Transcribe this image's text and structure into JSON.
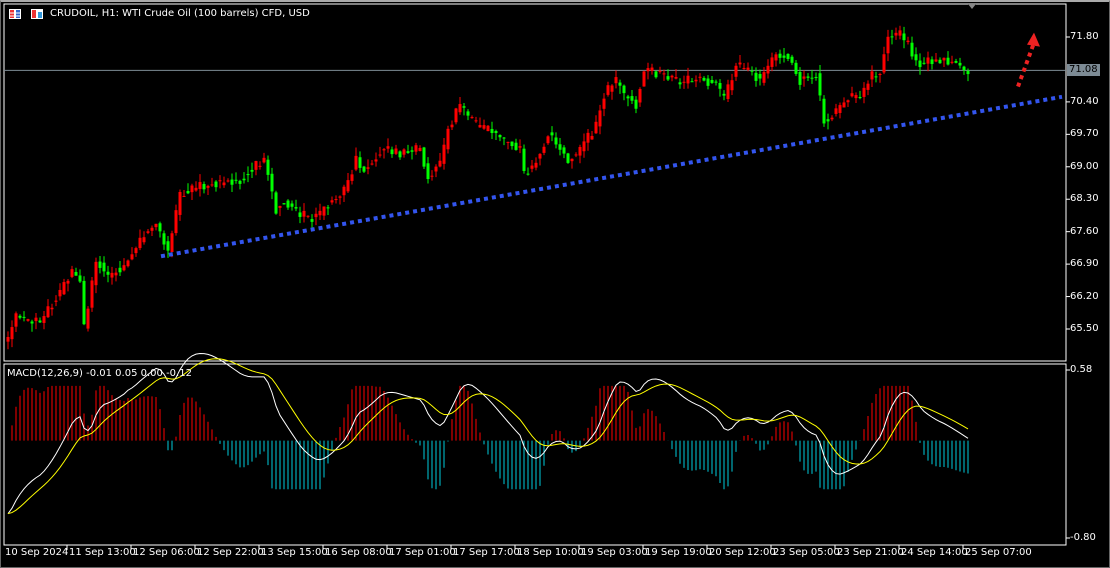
{
  "header": {
    "title": "CRUDOIL, H1:  WTI Crude Oil (100 barrels) CFD, USD",
    "icons": [
      "chart-window-icon",
      "one-click-trading-icon"
    ]
  },
  "macd_panel": {
    "label": "MACD(12,26,9) -0.01 0.05 0.00 -0.12",
    "y_max": "0.58",
    "y_min": "-0.80"
  },
  "colors": {
    "bull": "#ff0000",
    "bear": "#00ff00",
    "trendline": "#3355ee",
    "arrow": "#ee2222",
    "macd_main": "#ffffff",
    "macd_signal": "#ffff00",
    "hist_pos": "#ff0000",
    "hist_neg": "#00ccdd",
    "current_price_line": "#7d8b95"
  },
  "chart_data": {
    "type": "candlestick",
    "symbol": "CRUDOIL",
    "timeframe": "H1",
    "current_price": "71.08",
    "y_ticks": [
      "71.80",
      "70.40",
      "69.70",
      "69.00",
      "68.30",
      "67.60",
      "66.90",
      "66.20",
      "65.50"
    ],
    "ylim": [
      65.2,
      72.5
    ],
    "x_tick_labels": [
      "10 Sep 2024",
      "11 Sep 13:00",
      "12 Sep 06:00",
      "12 Sep 22:00",
      "13 Sep 15:00",
      "16 Sep 08:00",
      "17 Sep 01:00",
      "17 Sep 17:00",
      "18 Sep 10:00",
      "19 Sep 03:00",
      "19 Sep 19:00",
      "20 Sep 12:00",
      "23 Sep 05:00",
      "23 Sep 21:00",
      "24 Sep 14:00",
      "25 Sep 07:00"
    ],
    "bars_per_x_tick": 16,
    "close_path": [
      [
        0,
        65.3
      ],
      [
        2,
        65.74
      ],
      [
        8,
        65.69
      ],
      [
        12,
        66.17
      ],
      [
        16,
        66.71
      ],
      [
        18,
        66.5
      ],
      [
        19,
        65.53
      ],
      [
        22,
        66.99
      ],
      [
        25,
        66.66
      ],
      [
        29,
        66.88
      ],
      [
        33,
        67.42
      ],
      [
        37,
        67.8
      ],
      [
        40,
        67.2
      ],
      [
        43,
        68.4
      ],
      [
        45,
        68.5
      ],
      [
        50,
        68.62
      ],
      [
        58,
        68.73
      ],
      [
        62,
        69.05
      ],
      [
        64,
        69.16
      ],
      [
        67,
        68.07
      ],
      [
        69,
        68.29
      ],
      [
        73,
        67.96
      ],
      [
        77,
        67.9
      ],
      [
        80,
        68.18
      ],
      [
        84,
        68.5
      ],
      [
        87,
        69.16
      ],
      [
        89,
        68.94
      ],
      [
        93,
        69.36
      ],
      [
        98,
        69.31
      ],
      [
        103,
        69.4
      ],
      [
        105,
        68.82
      ],
      [
        108,
        69.05
      ],
      [
        110,
        69.8
      ],
      [
        113,
        70.33
      ],
      [
        117,
        69.9
      ],
      [
        120,
        69.79
      ],
      [
        124,
        69.57
      ],
      [
        128,
        69.36
      ],
      [
        129,
        68.8
      ],
      [
        132,
        69.15
      ],
      [
        135,
        69.69
      ],
      [
        138,
        69.47
      ],
      [
        140,
        69.14
      ],
      [
        143,
        69.36
      ],
      [
        147,
        69.9
      ],
      [
        149,
        70.55
      ],
      [
        152,
        70.87
      ],
      [
        154,
        70.55
      ],
      [
        157,
        70.33
      ],
      [
        159,
        71.09
      ],
      [
        163,
        70.98
      ],
      [
        168,
        70.83
      ],
      [
        173,
        70.92
      ],
      [
        177,
        70.76
      ],
      [
        179,
        70.44
      ],
      [
        182,
        71.19
      ],
      [
        185,
        71.09
      ],
      [
        188,
        70.87
      ],
      [
        192,
        71.41
      ],
      [
        195,
        71.41
      ],
      [
        198,
        70.87
      ],
      [
        202,
        70.98
      ],
      [
        204,
        70.0
      ],
      [
        207,
        70.22
      ],
      [
        209,
        70.44
      ],
      [
        213,
        70.54
      ],
      [
        216,
        70.98
      ],
      [
        218,
        71.09
      ],
      [
        220,
        71.84
      ],
      [
        223,
        71.84
      ],
      [
        225,
        71.62
      ],
      [
        228,
        71.19
      ],
      [
        230,
        71.3
      ],
      [
        234,
        71.3
      ],
      [
        237,
        71.19
      ],
      [
        240,
        71.08
      ]
    ],
    "trendline": {
      "from": [
        39,
        67.07
      ],
      "to": [
        262,
        70.51
      ],
      "style": "dotted"
    },
    "arrow": {
      "from": [
        250,
        70.73
      ],
      "to": [
        254,
        71.85
      ],
      "direction": "up",
      "style": "dotted"
    },
    "macd": {
      "fast": 12,
      "slow": 26,
      "signal": 9,
      "ylim": [
        -0.8,
        0.58
      ]
    }
  }
}
